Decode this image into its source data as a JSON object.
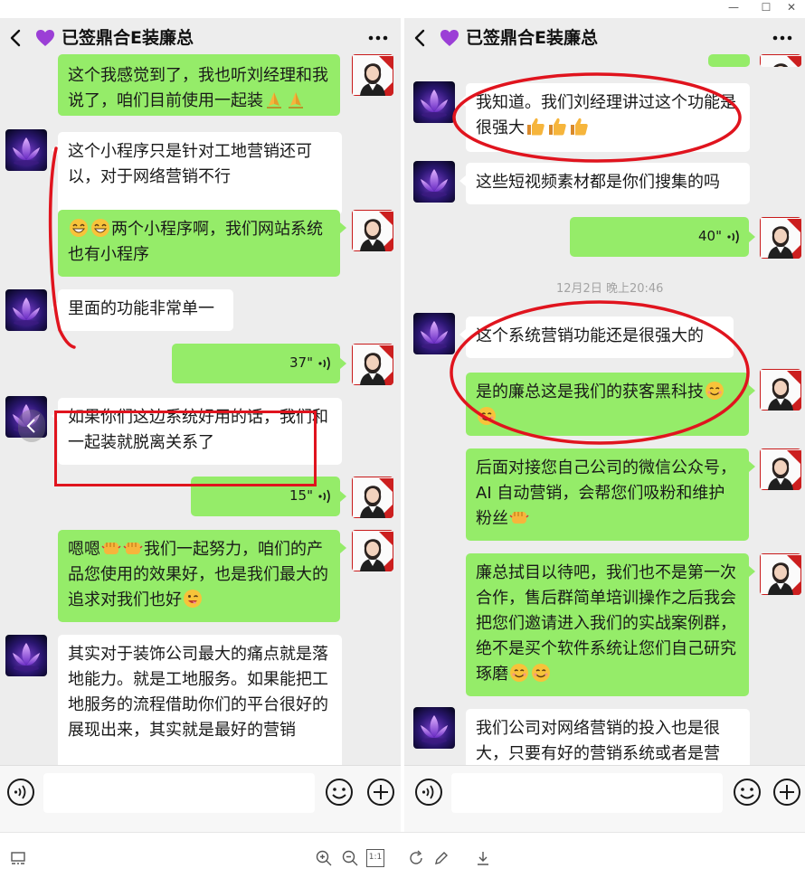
{
  "window": {
    "minimize_label": "—",
    "maximize_label": "☐",
    "close_label": "✕"
  },
  "left": {
    "title": "已签鼎合E装廉总",
    "messages": [
      {
        "text": "这个我感觉到了，我也听刘经理和我说了，咱们目前使用一起装"
      },
      {
        "text": "这个小程序只是针对工地营销还可以，对于网络营销不行"
      },
      {
        "text": "两个小程序啊，我们网站系统也有小程序"
      },
      {
        "text": "里面的功能非常单一"
      },
      {
        "duration": "37\""
      },
      {
        "text": "如果你们这边系统好用的话，我们和一起装就脱离关系了"
      },
      {
        "duration": "15\""
      },
      {
        "text_a": "嗯嗯",
        "text_b": "我们一起努力，咱们的产品您使用的效果好，也是我们最大的追求对我们也好"
      },
      {
        "text": "其实对于装饰公司最大的痛点就是落地能力。就是工地服务。如果能把工地服务的流程借助你们的平台很好的展现出来，其实就是最好的营销"
      }
    ]
  },
  "right": {
    "title": "已签鼎合E装廉总",
    "timestamp": "12月2日 晚上20:46",
    "messages": [
      {
        "text": "我知道。我们刘经理讲过这个功能是很强大"
      },
      {
        "text": "这些短视频素材都是你们搜集的吗"
      },
      {
        "duration": "40\""
      },
      {
        "text": "这个系统营销功能还是很强大的"
      },
      {
        "text": "是的廉总这是我们的获客黑科技"
      },
      {
        "text": "后面对接您自己公司的微信公众号，AI 自动营销，会帮您们吸粉和维护粉丝"
      },
      {
        "text": "廉总拭目以待吧，我们也不是第一次合作，售后群简单培训操作之后我会把您们邀请进入我们的实战案例群，绝不是买个软件系统让您们自己研究琢磨"
      },
      {
        "text": "我们公司对网络营销的投入也是很大，只要有好的营销系统或者是营"
      }
    ]
  },
  "toolbar": {
    "zoom_ratio_label": "1:1"
  },
  "colors": {
    "chat_bg": "#ededed",
    "bubble_green": "#95ec69",
    "bubble_white": "#ffffff",
    "annotation_red": "#e0141e",
    "heart_purple": "#9b3fd6"
  },
  "icons": [
    "back-icon",
    "heart-icon",
    "more-icon",
    "voice-input-icon",
    "emoji-icon",
    "plus-icon",
    "zoom-in-icon",
    "zoom-out-icon",
    "rotate-icon",
    "edit-icon",
    "download-icon",
    "thumbnail-icon"
  ]
}
